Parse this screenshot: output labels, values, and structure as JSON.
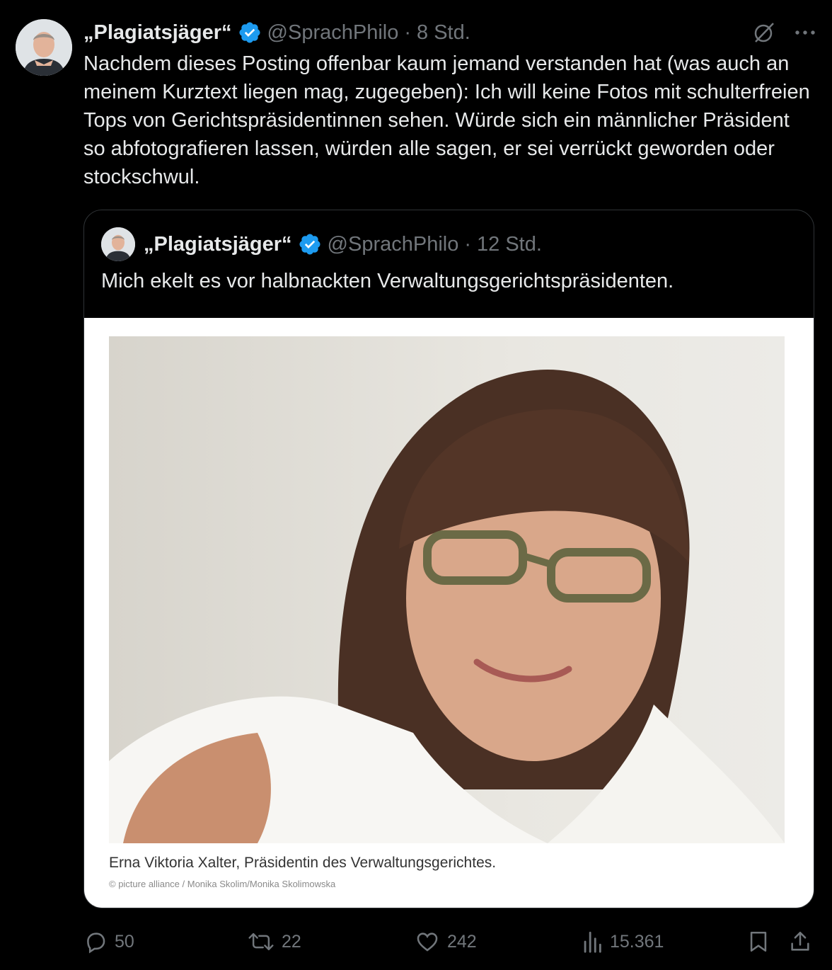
{
  "tweet": {
    "author_name": "„Plagiatsjäger“",
    "handle": "@SprachPhilo",
    "separator": "·",
    "time": "8 Std.",
    "text": "Nachdem dieses Posting offenbar kaum jemand verstanden hat (was auch an meinem Kurztext liegen mag, zugegeben): Ich will keine Fotos mit schulterfreien Tops von Gerichtspräsidentinnen sehen. Würde sich ein männlicher Präsident so abfotografieren lassen, würden alle sagen, er sei verrückt geworden oder stockschwul."
  },
  "quoted": {
    "author_name": "„Plagiatsjäger“",
    "handle": "@SprachPhilo",
    "separator": "·",
    "time": "12 Std.",
    "text": "Mich ekelt es vor halbnackten Verwaltungsgerichtspräsidenten.",
    "media_caption": "Erna Viktoria Xalter, Präsidentin des Verwaltungsgerichtes.",
    "media_credit": "© picture alliance / Monika Skolim/Monika Skolimowska"
  },
  "actions": {
    "replies": "50",
    "reposts": "22",
    "likes": "242",
    "views": "15.361"
  },
  "icons": {
    "verified": "verified-badge-icon",
    "grok": "grok-icon",
    "more": "more-icon",
    "reply": "reply-icon",
    "repost": "repost-icon",
    "like": "like-icon",
    "views": "views-icon",
    "bookmark": "bookmark-icon",
    "share": "share-icon"
  },
  "colors": {
    "background": "#000000",
    "text": "#e7e9ea",
    "secondary": "#71767b",
    "verified": "#1d9bf0",
    "border": "#2f3336"
  }
}
